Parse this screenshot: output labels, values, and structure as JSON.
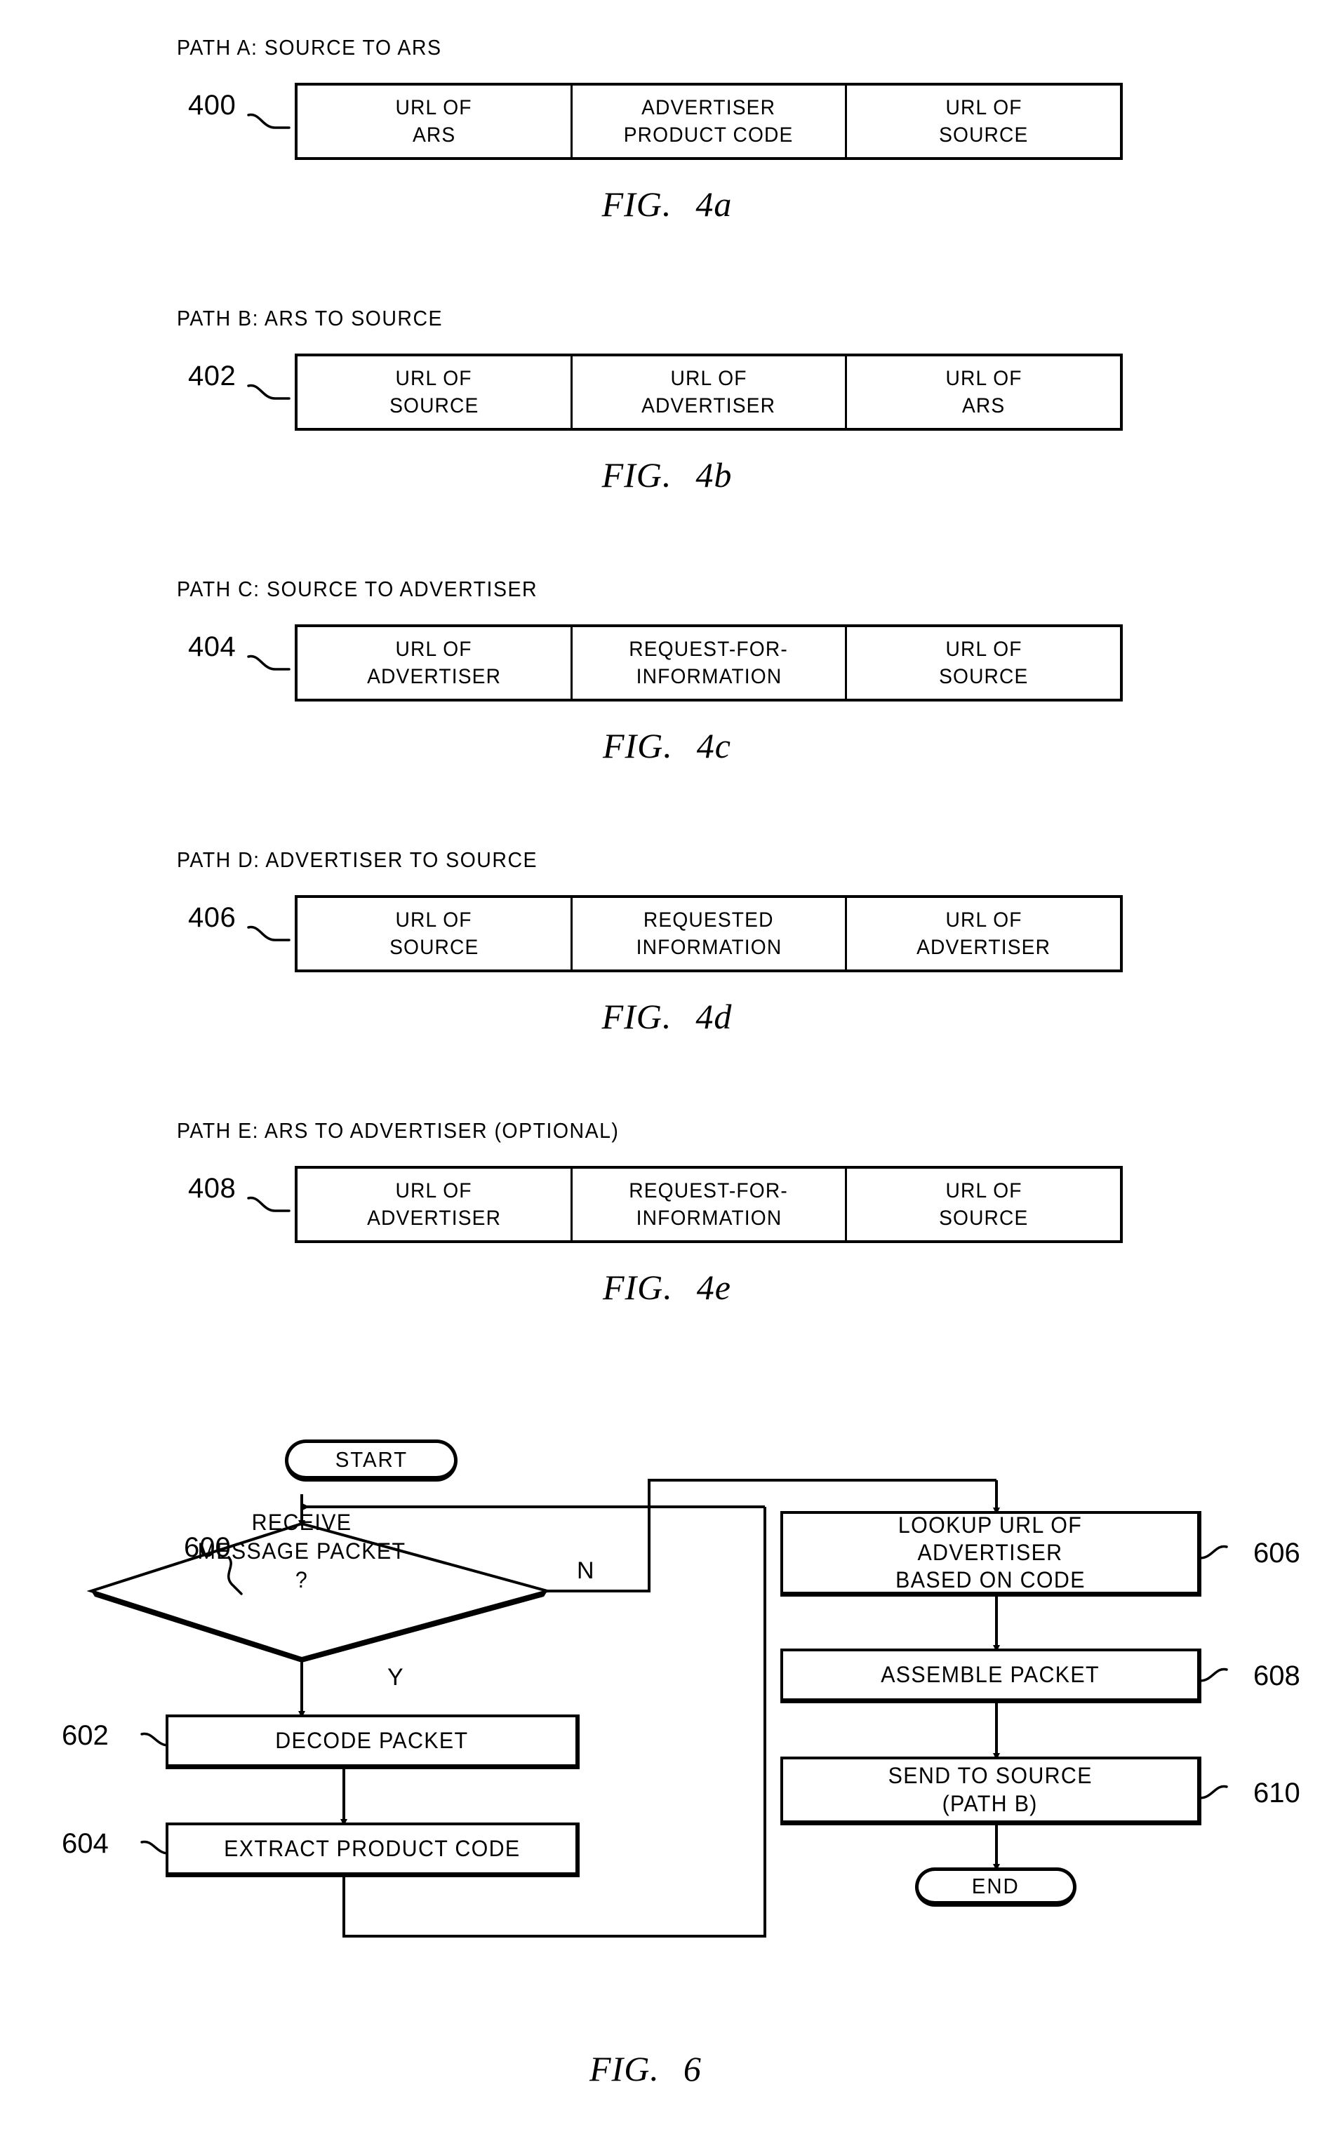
{
  "figures": [
    {
      "id": "fig4a",
      "title": "PATH A: SOURCE TO ARS",
      "ref": "400",
      "caption_prefix": "FIG.",
      "caption_number": "4a",
      "cells": [
        {
          "line1": "URL OF",
          "line2": "ARS"
        },
        {
          "line1": "ADVERTISER",
          "line2": "PRODUCT CODE"
        },
        {
          "line1": "URL OF",
          "line2": "SOURCE"
        }
      ]
    },
    {
      "id": "fig4b",
      "title": "PATH B: ARS TO SOURCE",
      "ref": "402",
      "caption_prefix": "FIG.",
      "caption_number": "4b",
      "cells": [
        {
          "line1": "URL OF",
          "line2": "SOURCE"
        },
        {
          "line1": "URL OF",
          "line2": "ADVERTISER"
        },
        {
          "line1": "URL OF",
          "line2": "ARS"
        }
      ]
    },
    {
      "id": "fig4c",
      "title": "PATH C: SOURCE TO ADVERTISER",
      "ref": "404",
      "caption_prefix": "FIG.",
      "caption_number": "4c",
      "cells": [
        {
          "line1": "URL OF",
          "line2": "ADVERTISER"
        },
        {
          "line1": "REQUEST-FOR-",
          "line2": "INFORMATION"
        },
        {
          "line1": "URL OF",
          "line2": "SOURCE"
        }
      ]
    },
    {
      "id": "fig4d",
      "title": "PATH D: ADVERTISER TO SOURCE",
      "ref": "406",
      "caption_prefix": "FIG.",
      "caption_number": "4d",
      "cells": [
        {
          "line1": "URL OF",
          "line2": "SOURCE"
        },
        {
          "line1": "REQUESTED",
          "line2": "INFORMATION"
        },
        {
          "line1": "URL OF",
          "line2": "ADVERTISER"
        }
      ]
    },
    {
      "id": "fig4e",
      "title": "PATH E: ARS TO ADVERTISER (OPTIONAL)",
      "ref": "408",
      "caption_prefix": "FIG.",
      "caption_number": "4e",
      "cells": [
        {
          "line1": "URL OF",
          "line2": "ADVERTISER"
        },
        {
          "line1": "REQUEST-FOR-",
          "line2": "INFORMATION"
        },
        {
          "line1": "URL OF",
          "line2": "SOURCE"
        }
      ]
    }
  ],
  "flowchart": {
    "caption_prefix": "FIG.",
    "caption_number": "6",
    "start": "START",
    "end": "END",
    "decision": {
      "ref": "600",
      "line1": "RECEIVE",
      "line2": "MESSAGE PACKET",
      "line3": "?",
      "branch_yes": "Y",
      "branch_no": "N"
    },
    "steps": [
      {
        "ref": "602",
        "line1": "DECODE PACKET"
      },
      {
        "ref": "604",
        "line1": "EXTRACT PRODUCT CODE"
      },
      {
        "ref": "606",
        "line1": "LOOKUP URL OF",
        "line2": "ADVERTISER",
        "line3": "BASED ON CODE"
      },
      {
        "ref": "608",
        "line1": "ASSEMBLE PACKET"
      },
      {
        "ref": "610",
        "line1": "SEND TO SOURCE",
        "line2": "(PATH B)"
      }
    ]
  }
}
